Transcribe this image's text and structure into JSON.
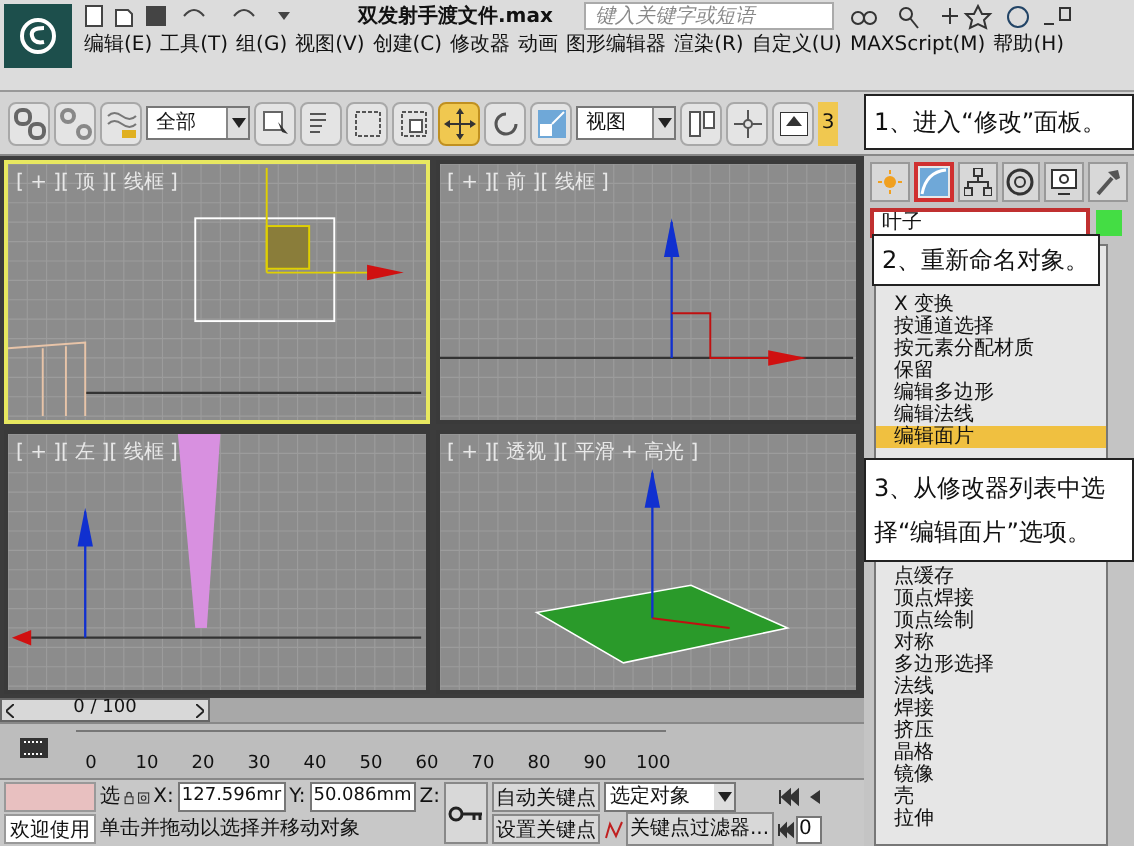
{
  "title_bar": {
    "title": "双发射手渡文件.max",
    "search_placeholder": "键入关键字或短语"
  },
  "menu": [
    "编辑(E)",
    "工具(T)",
    "组(G)",
    "视图(V)",
    "创建(C)",
    "修改器",
    "动画",
    "图形编辑器",
    "渲染(R)",
    "自定义(U)",
    "MAXScript(M)",
    "帮助(H)"
  ],
  "toolbar": {
    "selection_filter": "全部",
    "coord_system": "视图",
    "snap_label": "3"
  },
  "viewports": [
    {
      "label": "[ + ][ 顶 ][ 线框 ]",
      "kind": "top",
      "active": true
    },
    {
      "label": "[ + ][ 前 ][ 线框 ]",
      "kind": "front",
      "active": false
    },
    {
      "label": "[ + ][ 左 ][ 线框 ]",
      "kind": "left",
      "active": false
    },
    {
      "label": "[ + ][ 透视 ][ 平滑 + 高光 ]",
      "kind": "perspective",
      "active": false
    }
  ],
  "command_panel": {
    "tabs": [
      {
        "kind": "create",
        "selected": false
      },
      {
        "kind": "modify",
        "selected": true
      },
      {
        "kind": "hierarchy",
        "selected": false
      },
      {
        "kind": "motion",
        "selected": false
      },
      {
        "kind": "display",
        "selected": false
      },
      {
        "kind": "utilities",
        "selected": false
      }
    ],
    "object_name": "叶子",
    "modifiers": [
      {
        "label": "X 变换",
        "selected": false
      },
      {
        "label": "按通道选择",
        "selected": false
      },
      {
        "label": "按元素分配材质",
        "selected": false
      },
      {
        "label": "保留",
        "selected": false
      },
      {
        "label": "编辑多边形",
        "selected": false
      },
      {
        "label": "编辑法线",
        "selected": false
      },
      {
        "label": "编辑面片",
        "selected": true
      }
    ],
    "modifiers_below": [
      {
        "label": "点缓存",
        "selected": false
      },
      {
        "label": "顶点焊接",
        "selected": false
      },
      {
        "label": "顶点绘制",
        "selected": false
      },
      {
        "label": "对称",
        "selected": false
      },
      {
        "label": "多边形选择",
        "selected": false
      },
      {
        "label": "法线",
        "selected": false
      },
      {
        "label": "焊接",
        "selected": false
      },
      {
        "label": "挤压",
        "selected": false
      },
      {
        "label": "晶格",
        "selected": false
      },
      {
        "label": "镜像",
        "selected": false
      },
      {
        "label": "壳",
        "selected": false
      },
      {
        "label": "拉伸",
        "selected": false
      }
    ]
  },
  "callouts": [
    "1、进入“修改”面板。",
    "2、重新命名对象。",
    "3、从修改器列表中选择“编辑面片”选项。"
  ],
  "timeline": {
    "position": "0 / 100",
    "ticks": [
      "0",
      "10",
      "20",
      "30",
      "40",
      "50",
      "60",
      "70",
      "80",
      "90",
      "100"
    ]
  },
  "status": {
    "welcome": "欢迎使用",
    "select_label": "选",
    "x_label": "X:",
    "x_value": "127.596mr",
    "y_label": "Y:",
    "y_value": "50.086mm",
    "z_label": "Z:",
    "message": "单击并拖动以选择并移动对象",
    "auto_key": "自动关键点",
    "set_key": "设置关键点",
    "key_mode": "选定对象",
    "key_filters": "关键点过滤器...",
    "frame": "0"
  }
}
